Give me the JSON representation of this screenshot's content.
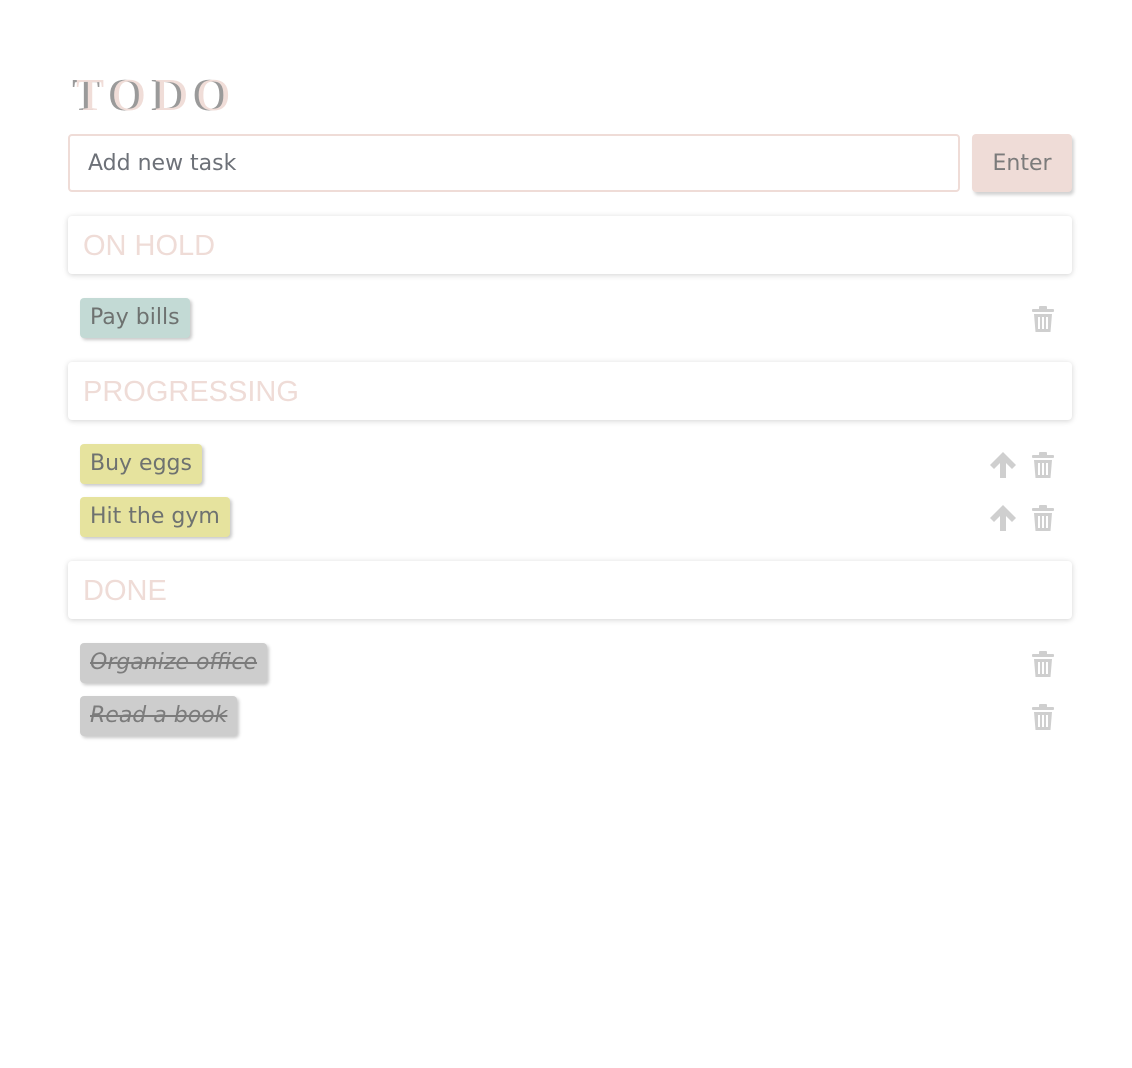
{
  "app": {
    "title": "TODO"
  },
  "new_task": {
    "placeholder": "Add new task",
    "value": "",
    "enter_label": "Enter"
  },
  "sections": {
    "on_hold": {
      "label": "ON HOLD",
      "tasks": [
        "Pay bills"
      ]
    },
    "progressing": {
      "label": "PROGRESSING",
      "tasks": [
        "Buy eggs",
        "Hit the gym"
      ]
    },
    "done": {
      "label": "DONE",
      "tasks": [
        "Organize office",
        "Read a book"
      ]
    }
  },
  "icons": {
    "delete": "trash-icon",
    "move_up": "arrow-up-icon"
  },
  "colors": {
    "accent": "#efdcd7",
    "on_hold_chip": "#c3dad5",
    "progressing_chip": "#e6e39e",
    "done_chip": "#cdcdcd",
    "icon": "#cfcfcf"
  }
}
